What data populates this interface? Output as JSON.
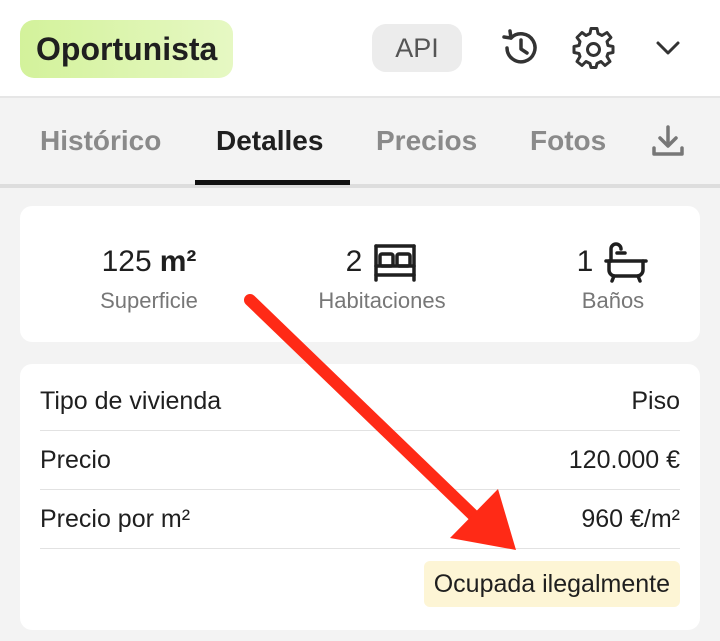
{
  "header": {
    "brand": "Oportunista",
    "api_label": "API",
    "icons": [
      "history-icon",
      "gear-icon",
      "chevron-down-icon"
    ]
  },
  "tabs": [
    {
      "label": "Histórico",
      "active": false
    },
    {
      "label": "Detalles",
      "active": true
    },
    {
      "label": "Precios",
      "active": false
    },
    {
      "label": "Fotos",
      "active": false
    }
  ],
  "download_icon": "download-icon",
  "stats": {
    "surface": {
      "value": "125",
      "unit": "m²",
      "label": "Superficie"
    },
    "rooms": {
      "value": "2",
      "icon": "bed-icon",
      "label": "Habitaciones"
    },
    "baths": {
      "value": "1",
      "icon": "bathtub-icon",
      "label": "Baños"
    }
  },
  "details": {
    "rows": [
      {
        "label": "Tipo de vivienda",
        "value": "Piso"
      },
      {
        "label": "Precio",
        "value": "120.000 €"
      },
      {
        "label": "Precio por m²",
        "value": "960 €/m²"
      }
    ],
    "badge": "Ocupada ilegalmente"
  },
  "colors": {
    "brand_gradient_start": "#d3f29b",
    "brand_gradient_end": "#e6f8c3",
    "badge_bg": "#fdf5d5",
    "annotation_arrow": "#ff2a16"
  }
}
